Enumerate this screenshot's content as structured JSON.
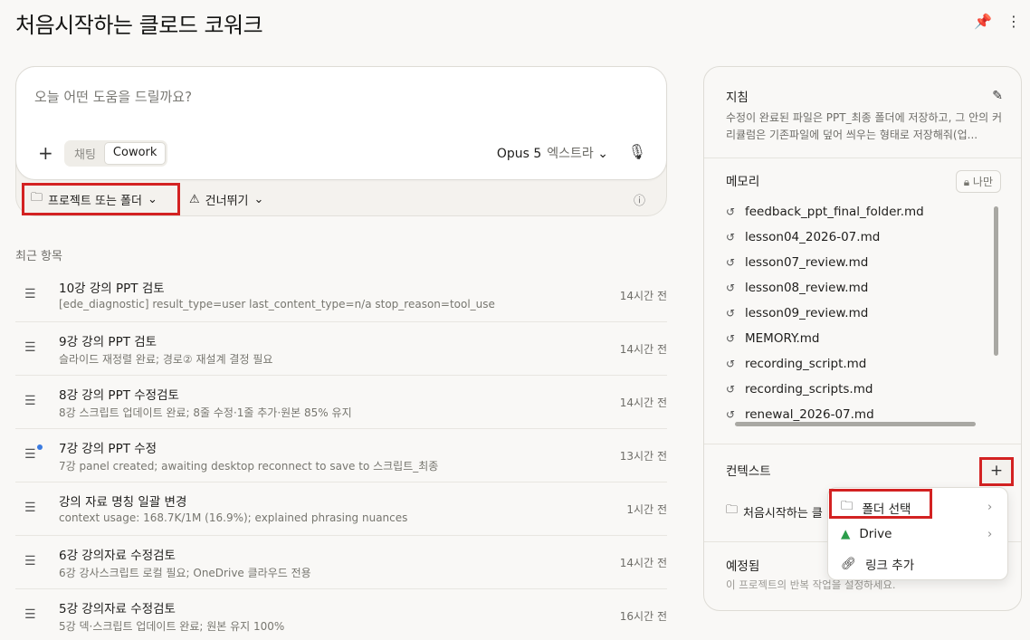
{
  "page": {
    "title": "처음시작하는 클로드 코워크"
  },
  "composer": {
    "placeholder": "오늘 어떤 도움을 드릴까요?",
    "modes": [
      "채팅",
      "Cowork"
    ],
    "model": "Opus 5",
    "effort": "엑스트라"
  },
  "toolbar": {
    "folder_label": "프로젝트 또는 폴더",
    "skip_label": "건너뛰기"
  },
  "recent": {
    "label": "최근 항목",
    "items": [
      {
        "title": "10강 강의 PPT 검토",
        "subtitle": "[ede_diagnostic] result_type=user last_content_type=n/a stop_reason=tool_use",
        "time": "14시간 전"
      },
      {
        "title": "9강 강의 PPT 검토",
        "subtitle": "슬라이드 재정렬 완료; 경로② 재설계 결정 필요",
        "time": "14시간 전"
      },
      {
        "title": "8강 강의 PPT 수정검토",
        "subtitle": "8강 스크립트 업데이트 완료; 8줄 수정·1줄 추가·원본 85% 유지",
        "time": "14시간 전"
      },
      {
        "title": "7강 강의 PPT 수정",
        "subtitle": "7강 panel created; awaiting desktop reconnect to save to 스크립트_최종",
        "time": "13시간 전"
      },
      {
        "title": "강의 자료 명칭 일괄 변경",
        "subtitle": "context usage: 168.7K/1M (16.9%); explained phrasing nuances",
        "time": "1시간 전"
      },
      {
        "title": "6강 강의자료 수정검토",
        "subtitle": "6강 강사스크립트 로컬 필요; OneDrive 클라우드 전용",
        "time": "14시간 전"
      },
      {
        "title": "5강 강의자료 수정검토",
        "subtitle": "5강 덱·스크립트 업데이트 완료; 원본 유지 100%",
        "time": "16시간 전"
      }
    ]
  },
  "panel": {
    "instructions_title": "지침",
    "instructions_text": "수정이 완료된 파일은 PPT_최종 폴더에 저장하고, 그 안의 커리큘럼은 기존파일에 덮어 씌우는 형태로 저장해줘(업...",
    "memory_title": "메모리",
    "memory_badge": "나만",
    "memory_files": [
      "feedback_ppt_final_folder.md",
      "lesson04_2026-07.md",
      "lesson07_review.md",
      "lesson08_review.md",
      "lesson09_review.md",
      "MEMORY.md",
      "recording_script.md",
      "recording_scripts.md",
      "renewal_2026-07.md"
    ],
    "context_title": "컨텍스트",
    "context_item": "처음시작하는 클",
    "scheduled_title": "예정됨",
    "scheduled_text": "이 프로젝트의 반복 작업을 설정하세요."
  },
  "menu": {
    "items": [
      "폴더 선택",
      "Drive",
      "링크 추가"
    ]
  }
}
